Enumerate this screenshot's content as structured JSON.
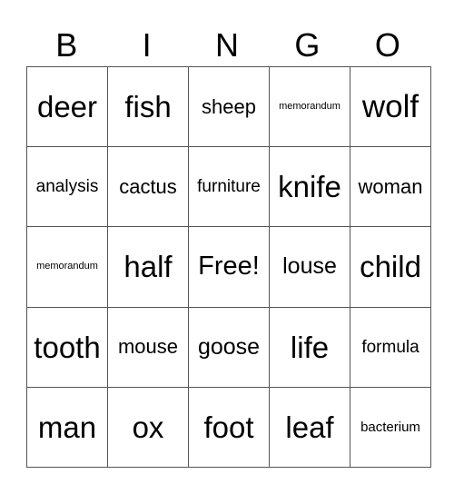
{
  "header": [
    "B",
    "I",
    "N",
    "G",
    "O"
  ],
  "rows": [
    [
      "deer",
      "fish",
      "sheep",
      "memorandum",
      "wolf"
    ],
    [
      "analysis",
      "cactus",
      "furniture",
      "knife",
      "woman"
    ],
    [
      "memorandum",
      "half",
      "Free!",
      "louse",
      "child"
    ],
    [
      "tooth",
      "mouse",
      "goose",
      "life",
      "formula"
    ],
    [
      "man",
      "ox",
      "foot",
      "leaf",
      "bacterium"
    ]
  ]
}
